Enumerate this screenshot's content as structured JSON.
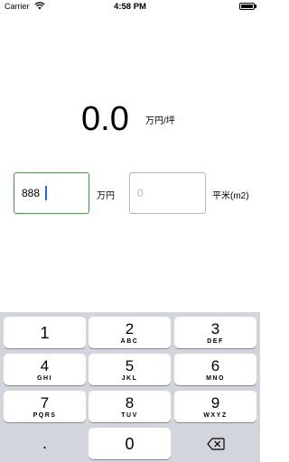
{
  "status_bar": {
    "carrier": "Carrier",
    "time": "4:58 PM"
  },
  "result": {
    "value": "0.0",
    "unit": "万円/坪"
  },
  "inputs": {
    "price": {
      "value": "888",
      "unit": "万円"
    },
    "area": {
      "placeholder": "0",
      "unit": "平米(m2)"
    }
  },
  "keypad": {
    "keys": [
      {
        "digit": "1",
        "letters": ""
      },
      {
        "digit": "2",
        "letters": "ABC"
      },
      {
        "digit": "3",
        "letters": "DEF"
      },
      {
        "digit": "4",
        "letters": "GHI"
      },
      {
        "digit": "5",
        "letters": "JKL"
      },
      {
        "digit": "6",
        "letters": "MNO"
      },
      {
        "digit": "7",
        "letters": "PQRS"
      },
      {
        "digit": "8",
        "letters": "TUV"
      },
      {
        "digit": "9",
        "letters": "WXYZ"
      },
      {
        "digit": "0",
        "letters": ""
      }
    ],
    "decimal": ".",
    "icons": {
      "backspace": "backspace-icon"
    }
  }
}
